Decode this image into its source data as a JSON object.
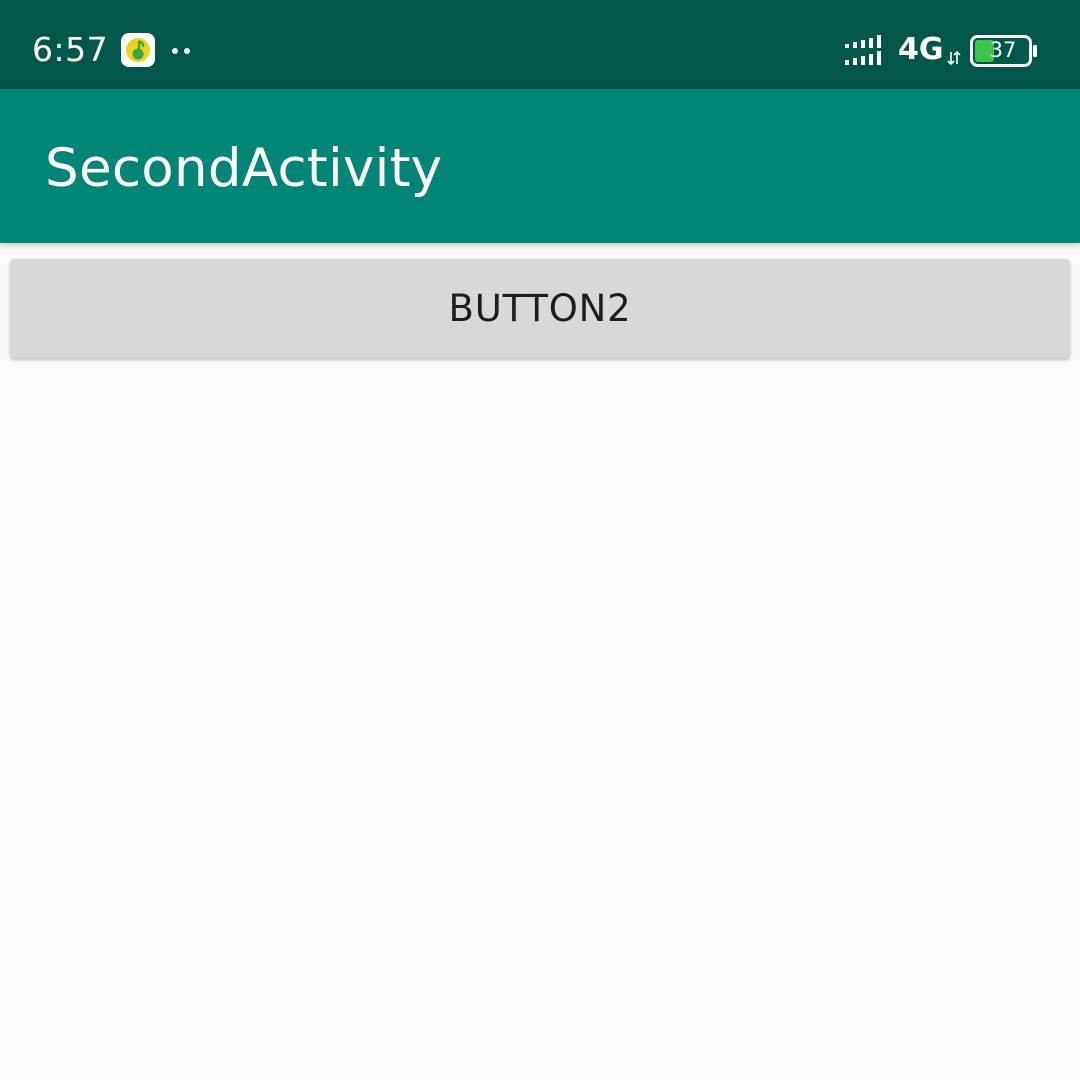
{
  "status_bar": {
    "time": "6:57",
    "network": "4G",
    "battery_level": "37",
    "background_color": "#02574a",
    "notification_icon": "music-app-icon",
    "signal_icon": "signal-strength-icon",
    "battery_icon": "battery-icon",
    "battery_fill_fraction": 0.37
  },
  "app_bar": {
    "title": "SecondActivity",
    "background_color": "#008577"
  },
  "main": {
    "button_label": "BUTTON2",
    "button_color": "#d7d9d9",
    "background_color": "#fafafa"
  }
}
